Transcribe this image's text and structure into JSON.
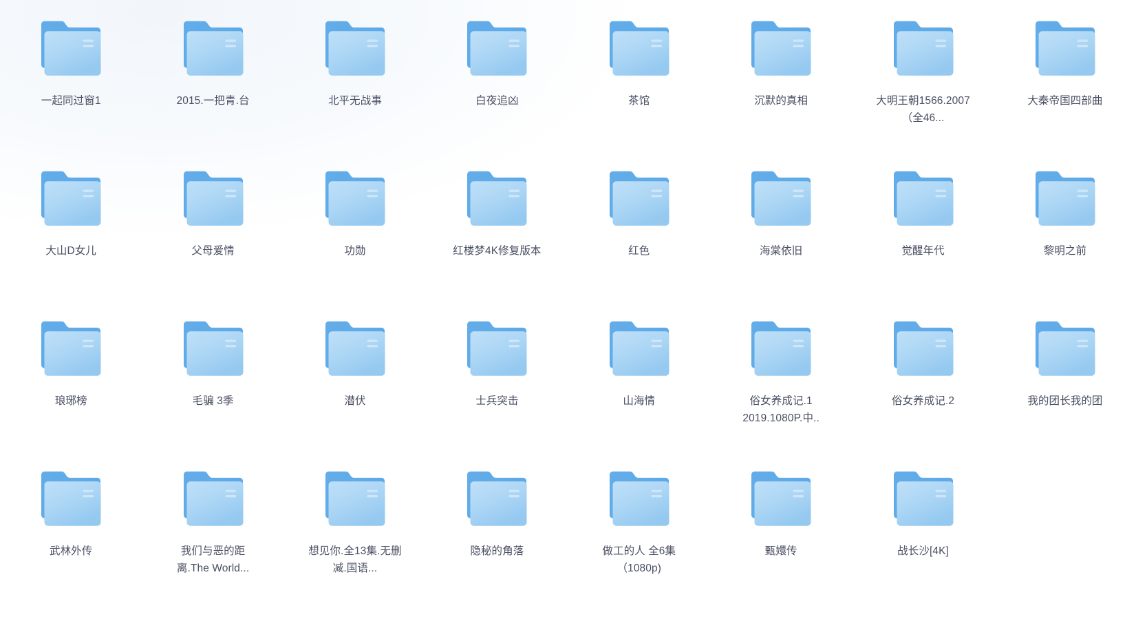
{
  "view": {
    "type": "file-manager-icon-grid",
    "columns": 8,
    "rows": 4,
    "background_color": "#ffffff",
    "label_color": "#4a4f63",
    "folder_accent_color": "#64afea",
    "folder_face_color": "#a8d4f4"
  },
  "icon": {
    "name": "folder-icon",
    "tab_color": "#62ade9",
    "body_top_color": "#bfe0f8",
    "body_bottom_color": "#95c9f0",
    "lines_color": "#cfe6fa"
  },
  "items": [
    {
      "name": "一起同过窗1"
    },
    {
      "name": "2015.一把青.台"
    },
    {
      "name": "北平无战事"
    },
    {
      "name": "白夜追凶"
    },
    {
      "name": "茶馆"
    },
    {
      "name": "沉默的真相"
    },
    {
      "name": "大明王朝1566.2007（全46..."
    },
    {
      "name": "大秦帝国四部曲"
    },
    {
      "name": "大山D女儿"
    },
    {
      "name": "父母爱情"
    },
    {
      "name": "功勋"
    },
    {
      "name": "红楼梦4K修复版本"
    },
    {
      "name": "红色"
    },
    {
      "name": "海棠依旧"
    },
    {
      "name": "觉醒年代"
    },
    {
      "name": "黎明之前"
    },
    {
      "name": "琅琊榜"
    },
    {
      "name": "毛骗 3季"
    },
    {
      "name": "潜伏"
    },
    {
      "name": "士兵突击"
    },
    {
      "name": "山海情"
    },
    {
      "name": "俗女养成记.1 2019.1080P.中.."
    },
    {
      "name": "俗女养成记.2"
    },
    {
      "name": "我的团长我的团"
    },
    {
      "name": "武林外传"
    },
    {
      "name": "我们与恶的距离.The World..."
    },
    {
      "name": "想见你.全13集.无删减.国语..."
    },
    {
      "name": "隐秘的角落"
    },
    {
      "name": "做工的人 全6集 （1080p)"
    },
    {
      "name": "甄嬛传"
    },
    {
      "name": "战长沙[4K]"
    }
  ]
}
